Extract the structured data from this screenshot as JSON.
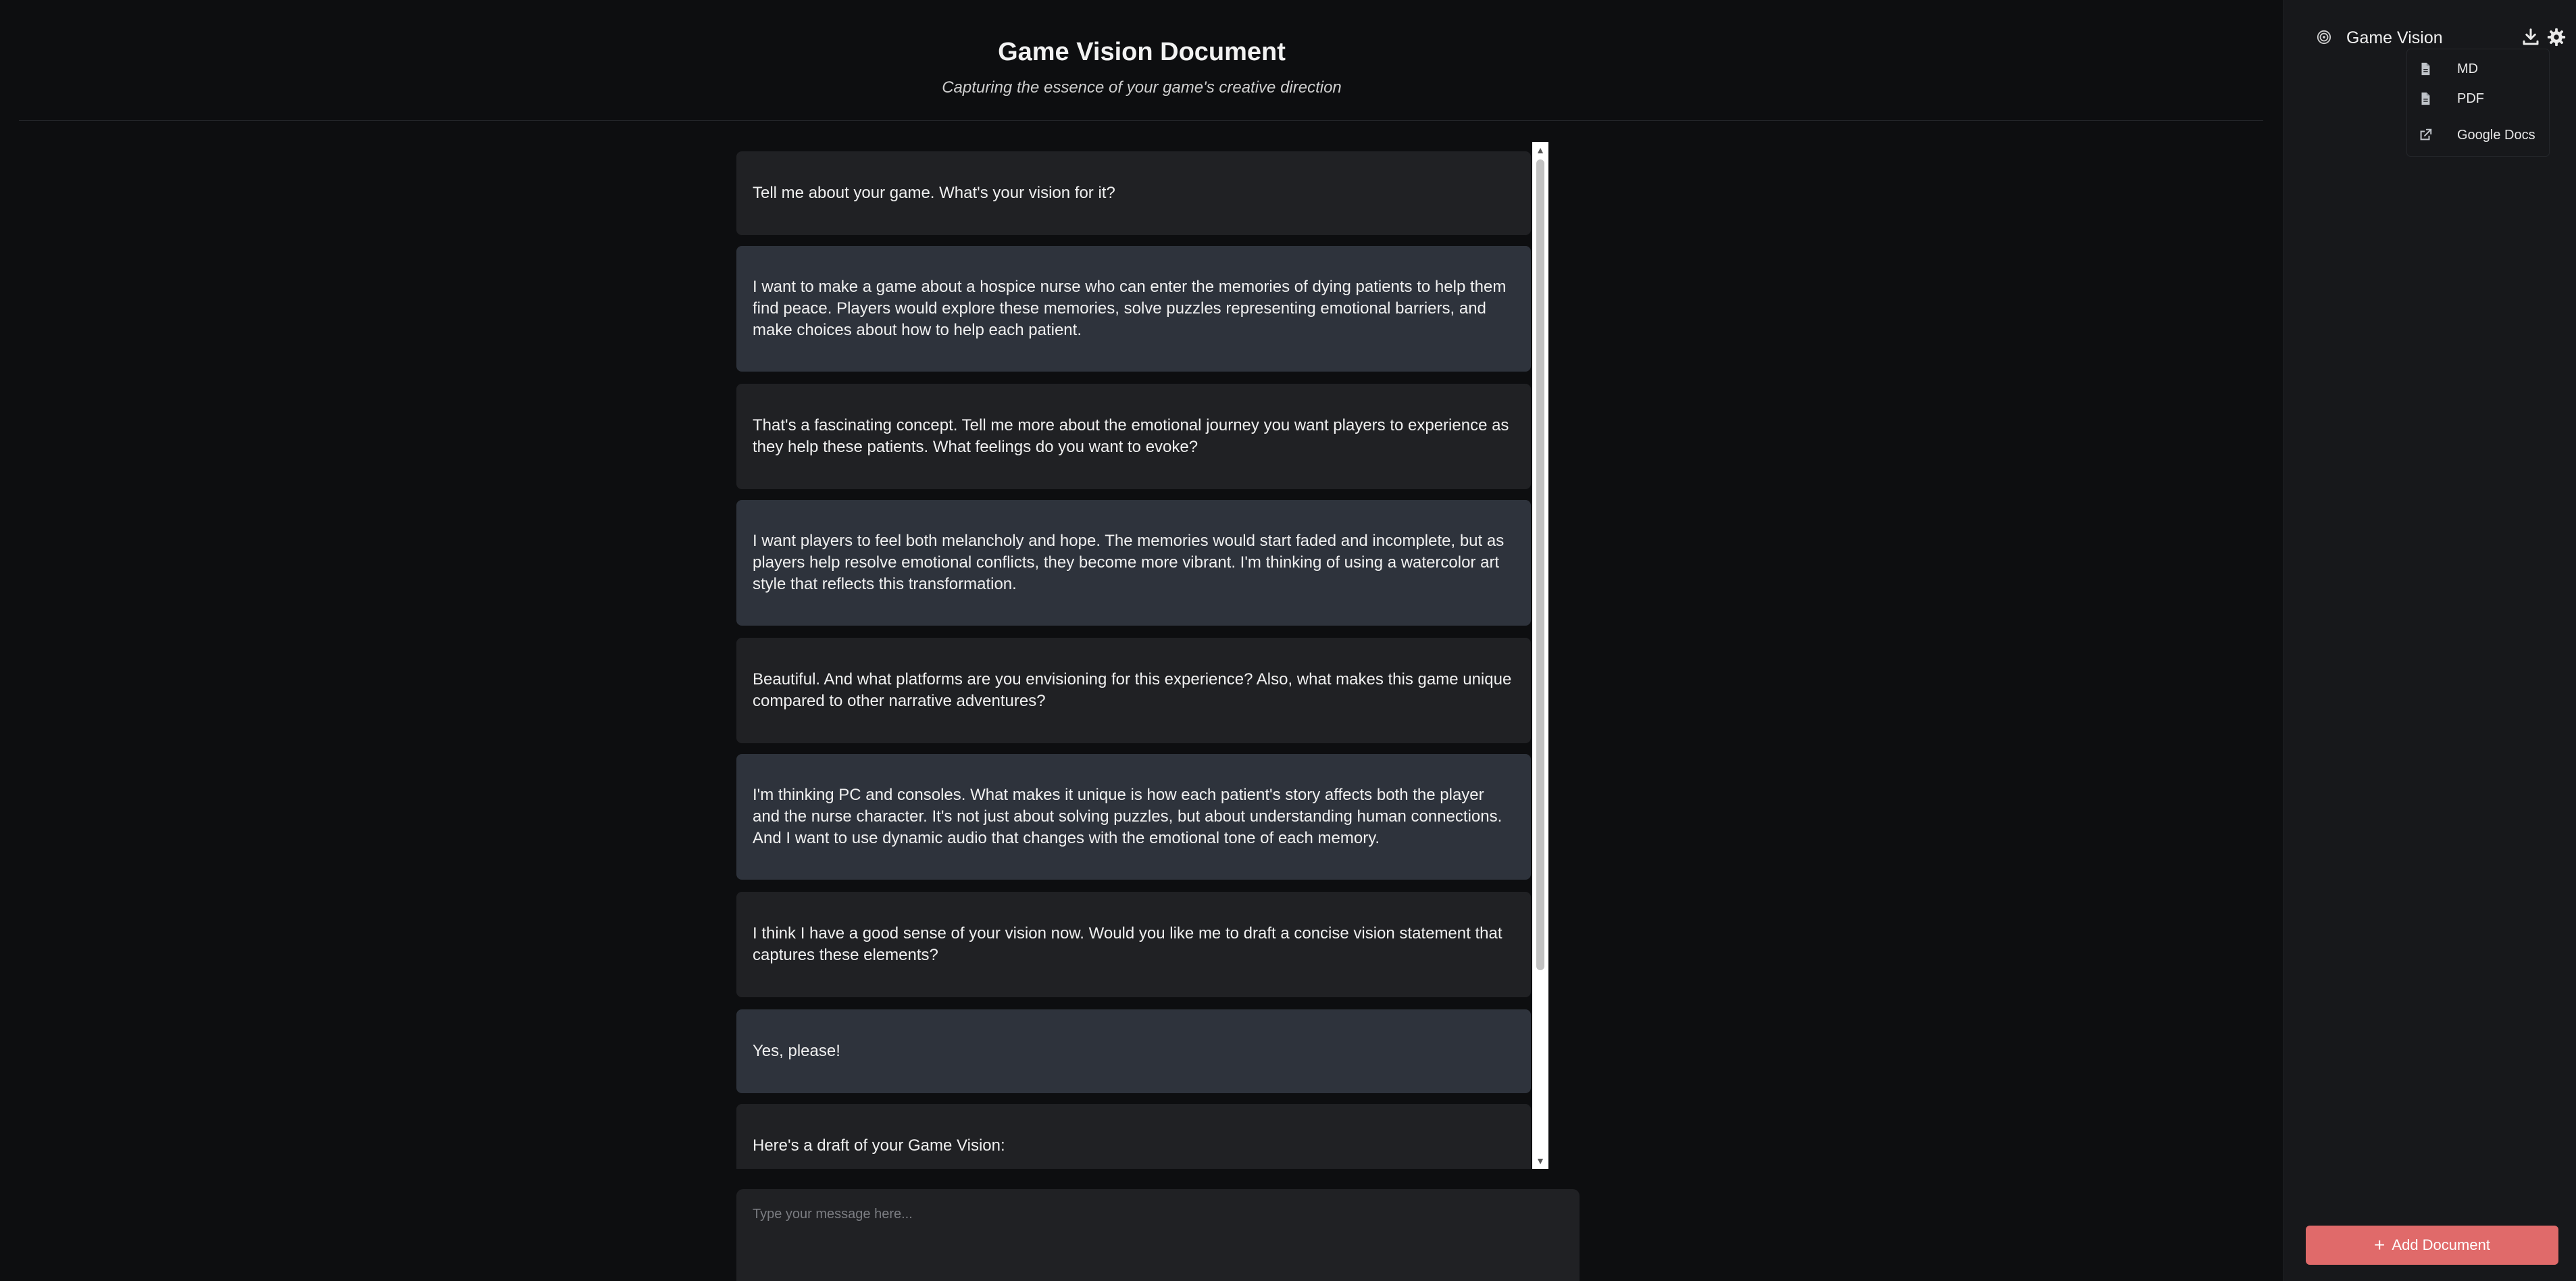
{
  "header": {
    "title": "Game Vision Document",
    "subtitle": "Capturing the essence of your game's creative direction"
  },
  "messages": [
    {
      "role": "assistant",
      "text": "Tell me about your game. What's your vision for it?"
    },
    {
      "role": "user",
      "text": "I want to make a game about a hospice nurse who can enter the memories of dying patients to help them find peace. Players would explore these memories, solve puzzles representing emotional barriers, and make choices about how to help each patient."
    },
    {
      "role": "assistant",
      "text": "That's a fascinating concept. Tell me more about the emotional journey you want players to experience as they help these patients. What feelings do you want to evoke?"
    },
    {
      "role": "user",
      "text": "I want players to feel both melancholy and hope. The memories would start faded and incomplete, but as players help resolve emotional conflicts, they become more vibrant. I'm thinking of using a watercolor art style that reflects this transformation."
    },
    {
      "role": "assistant",
      "text": "Beautiful. And what platforms are you envisioning for this experience? Also, what makes this game unique compared to other narrative adventures?"
    },
    {
      "role": "user",
      "text": "I'm thinking PC and consoles. What makes it unique is how each patient's story affects both the player and the nurse character. It's not just about solving puzzles, but about understanding human connections. And I want to use dynamic audio that changes with the emotional tone of each memory."
    },
    {
      "role": "assistant",
      "text": "I think I have a good sense of your vision now. Would you like me to draft a concise vision statement that captures these elements?"
    },
    {
      "role": "user",
      "text": "Yes, please!"
    },
    {
      "role": "assistant",
      "text": "Here's a draft of your Game Vision:"
    }
  ],
  "composer": {
    "placeholder": "Type your message here..."
  },
  "sidebar": {
    "title": "Game Vision",
    "export_menu": {
      "items": [
        {
          "label": "MD",
          "icon": "file-icon"
        },
        {
          "label": "PDF",
          "icon": "file-icon"
        },
        {
          "label": "Google Docs",
          "icon": "external-link-icon"
        }
      ]
    },
    "add_button_label": "Add Document"
  },
  "colors": {
    "background": "#0d0e10",
    "assistant_bubble": "#202124",
    "user_bubble": "#2e333c",
    "accent": "#e06a6a"
  }
}
